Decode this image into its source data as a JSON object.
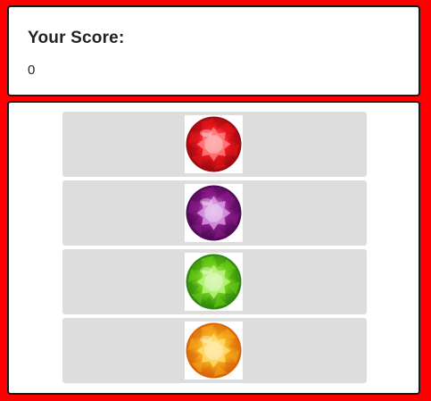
{
  "score": {
    "title": "Your Score:",
    "value": "0"
  },
  "gems": [
    {
      "name": "red-gem-icon",
      "color": "#e8141c",
      "dark": "#9e0a10",
      "light": "#ff8a8a"
    },
    {
      "name": "purple-gem-icon",
      "color": "#8a1a8a",
      "dark": "#4f0a55",
      "light": "#e0a8ec"
    },
    {
      "name": "green-gem-icon",
      "color": "#6ccd18",
      "dark": "#2f8a0c",
      "light": "#c8f590"
    },
    {
      "name": "orange-gem-icon",
      "color": "#f5a81a",
      "dark": "#d9650a",
      "light": "#ffe27a"
    }
  ]
}
